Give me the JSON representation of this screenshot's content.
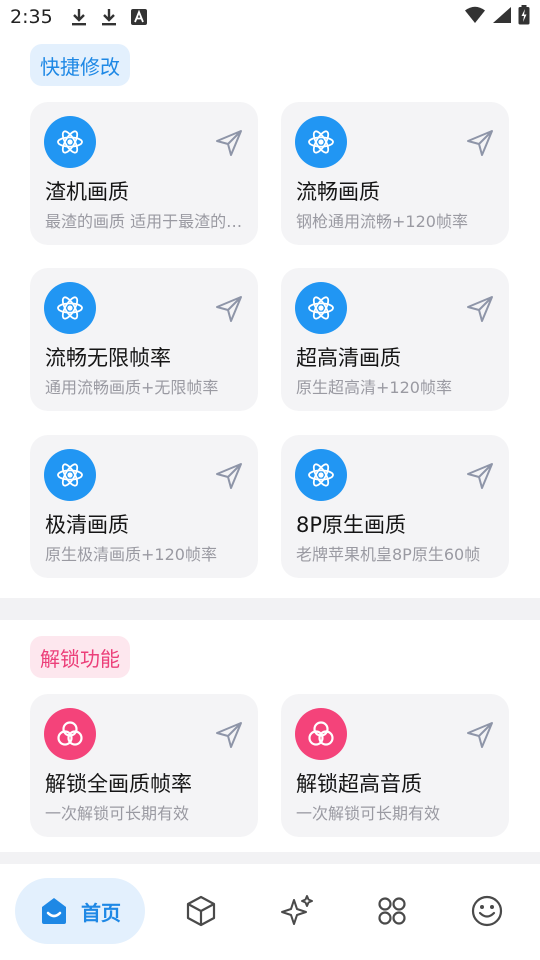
{
  "status_bar": {
    "time": "2:35"
  },
  "quick_section": {
    "label": "快捷修改",
    "cards": [
      {
        "title": "渣机画质",
        "subtitle": "最渣的画质 适用于最渣的手机"
      },
      {
        "title": "流畅画质",
        "subtitle": "钢枪通用流畅+120帧率"
      },
      {
        "title": "流畅无限帧率",
        "subtitle": "通用流畅画质+无限帧率"
      },
      {
        "title": "超高清画质",
        "subtitle": "原生超高清+120帧率"
      },
      {
        "title": "极清画质",
        "subtitle": "原生极清画质+120帧率"
      },
      {
        "title": "8P原生画质",
        "subtitle": "老牌苹果机皇8P原生60帧"
      }
    ]
  },
  "unlock_section": {
    "label": "解锁功能",
    "cards": [
      {
        "title": "解锁全画质帧率",
        "subtitle": "一次解锁可长期有效"
      },
      {
        "title": "解锁超高音质",
        "subtitle": "一次解锁可长期有效"
      }
    ]
  },
  "bottom_nav": {
    "home_label": "首页"
  },
  "colors": {
    "accent_blue": "#2196f3",
    "accent_pink": "#f4437a"
  }
}
